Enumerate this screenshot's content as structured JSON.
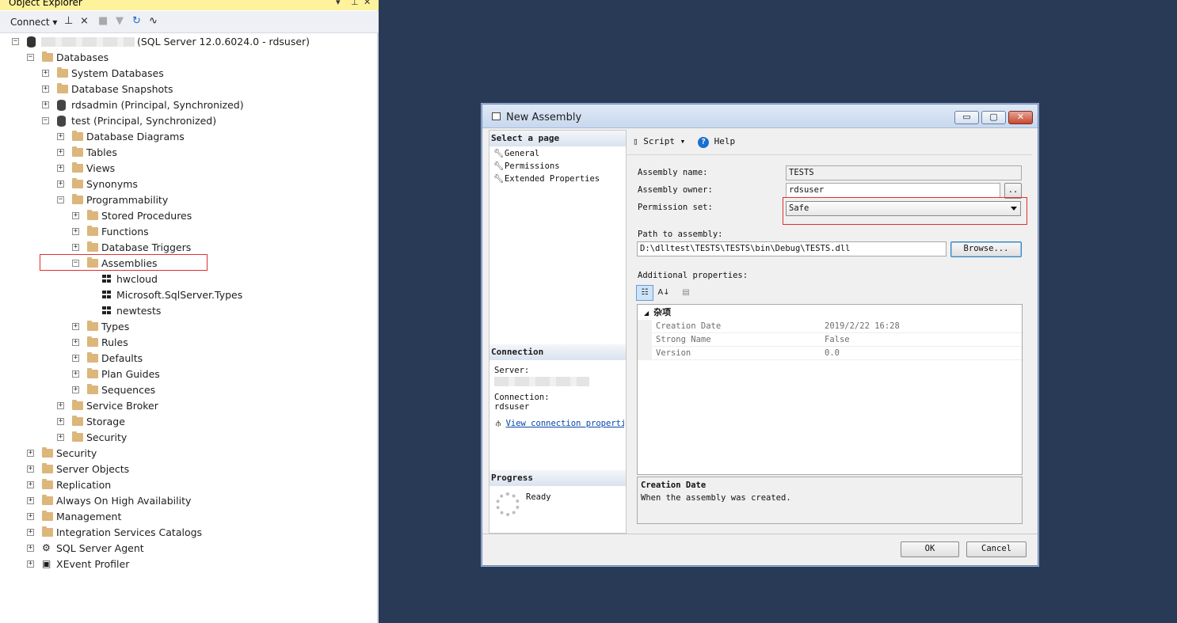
{
  "object_explorer": {
    "title": "Object Explorer",
    "title_controls": [
      "▾",
      "⊥",
      "✕"
    ],
    "toolbar": {
      "connect_label": "Connect ▾"
    },
    "tree": [
      {
        "label": "(SQL Server 12.0.6024.0 - rdsuser)",
        "level": 0,
        "expander": "⊟",
        "icon": "server-icon",
        "blurred_prefix": true
      },
      {
        "label": "Databases",
        "level": 1,
        "expander": "⊟",
        "icon": "folder-icon"
      },
      {
        "label": "System Databases",
        "level": 2,
        "expander": "⊞",
        "icon": "folder-icon"
      },
      {
        "label": "Database Snapshots",
        "level": 2,
        "expander": "⊞",
        "icon": "folder-icon"
      },
      {
        "label": "rdsadmin (Principal, Synchronized)",
        "level": 2,
        "expander": "⊞",
        "icon": "database-icon"
      },
      {
        "label": "test (Principal, Synchronized)",
        "level": 2,
        "expander": "⊟",
        "icon": "database-icon"
      },
      {
        "label": "Database Diagrams",
        "level": 3,
        "expander": "⊞",
        "icon": "folder-icon"
      },
      {
        "label": "Tables",
        "level": 3,
        "expander": "⊞",
        "icon": "folder-icon"
      },
      {
        "label": "Views",
        "level": 3,
        "expander": "⊞",
        "icon": "folder-icon"
      },
      {
        "label": "Synonyms",
        "level": 3,
        "expander": "⊞",
        "icon": "folder-icon"
      },
      {
        "label": "Programmability",
        "level": 3,
        "expander": "⊟",
        "icon": "folder-icon"
      },
      {
        "label": "Stored Procedures",
        "level": 4,
        "expander": "⊞",
        "icon": "folder-icon"
      },
      {
        "label": "Functions",
        "level": 4,
        "expander": "⊞",
        "icon": "folder-icon"
      },
      {
        "label": "Database Triggers",
        "level": 4,
        "expander": "⊞",
        "icon": "folder-icon"
      },
      {
        "label": "Assemblies",
        "level": 4,
        "expander": "⊟",
        "icon": "folder-icon"
      },
      {
        "label": "hwcloud",
        "level": 5,
        "expander": "",
        "icon": "assembly-icon"
      },
      {
        "label": "Microsoft.SqlServer.Types",
        "level": 5,
        "expander": "",
        "icon": "assembly-icon"
      },
      {
        "label": "newtests",
        "level": 5,
        "expander": "",
        "icon": "assembly-icon"
      },
      {
        "label": "Types",
        "level": 4,
        "expander": "⊞",
        "icon": "folder-icon"
      },
      {
        "label": "Rules",
        "level": 4,
        "expander": "⊞",
        "icon": "folder-icon"
      },
      {
        "label": "Defaults",
        "level": 4,
        "expander": "⊞",
        "icon": "folder-icon"
      },
      {
        "label": "Plan Guides",
        "level": 4,
        "expander": "⊞",
        "icon": "folder-icon"
      },
      {
        "label": "Sequences",
        "level": 4,
        "expander": "⊞",
        "icon": "folder-icon"
      },
      {
        "label": "Service Broker",
        "level": 3,
        "expander": "⊞",
        "icon": "folder-icon"
      },
      {
        "label": "Storage",
        "level": 3,
        "expander": "⊞",
        "icon": "folder-icon"
      },
      {
        "label": "Security",
        "level": 3,
        "expander": "⊞",
        "icon": "folder-icon"
      },
      {
        "label": "Security",
        "level": 1,
        "expander": "⊞",
        "icon": "folder-icon"
      },
      {
        "label": "Server Objects",
        "level": 1,
        "expander": "⊞",
        "icon": "folder-icon"
      },
      {
        "label": "Replication",
        "level": 1,
        "expander": "⊞",
        "icon": "folder-icon"
      },
      {
        "label": "Always On High Availability",
        "level": 1,
        "expander": "⊞",
        "icon": "folder-icon"
      },
      {
        "label": "Management",
        "level": 1,
        "expander": "⊞",
        "icon": "folder-icon"
      },
      {
        "label": "Integration Services Catalogs",
        "level": 1,
        "expander": "⊞",
        "icon": "folder-icon"
      },
      {
        "label": "SQL Server Agent",
        "level": 1,
        "expander": "⊞",
        "icon": "agent-icon"
      },
      {
        "label": "XEvent Profiler",
        "level": 1,
        "expander": "⊞",
        "icon": "profiler-icon"
      }
    ]
  },
  "dialog": {
    "title": "New Assembly",
    "window_buttons": [
      "▭",
      "▢",
      "✕"
    ],
    "select_page": {
      "heading": "Select a page",
      "items": [
        "General",
        "Permissions",
        "Extended Properties"
      ]
    },
    "connection": {
      "heading": "Connection",
      "server_label": "Server:",
      "connection_label": "Connection:",
      "connection_value": "rdsuser",
      "view_link": "View connection properties"
    },
    "progress": {
      "heading": "Progress",
      "status": "Ready"
    },
    "toolbar": {
      "script_label": "Script",
      "help_label": "Help",
      "help_glyph": "?"
    },
    "form": {
      "assembly_name_label": "Assembly name:",
      "assembly_name_value": "TESTS",
      "assembly_owner_label": "Assembly owner:",
      "assembly_owner_value": "rdsuser",
      "owner_browse_label": "..",
      "permission_set_label": "Permission set:",
      "permission_set_value": "Safe",
      "path_label": "Path to assembly:",
      "path_value": "D:\\dlltest\\TESTS\\TESTS\\bin\\Debug\\TESTS.dll",
      "browse_label": "Browse...",
      "additional_label": "Additional properties:"
    },
    "properties": {
      "category": "杂项",
      "rows": [
        {
          "name": "Creation Date",
          "value": "2019/2/22 16:28"
        },
        {
          "name": "Strong Name",
          "value": "False"
        },
        {
          "name": "Version",
          "value": "0.0"
        }
      ],
      "description_title": "Creation Date",
      "description_text": "When the assembly was created."
    },
    "buttons": {
      "ok": "OK",
      "cancel": "Cancel"
    }
  }
}
